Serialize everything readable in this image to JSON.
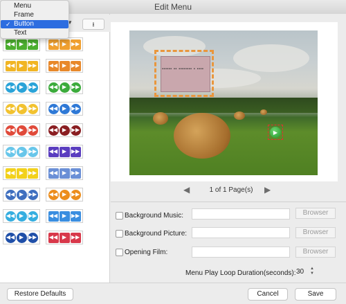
{
  "window": {
    "title": "Edit Menu"
  },
  "toolbar": {
    "download_glyph": "⭳"
  },
  "object_menu": {
    "items": [
      {
        "label": "Menu",
        "checked": false
      },
      {
        "label": "Frame",
        "checked": false
      },
      {
        "label": "Button",
        "checked": true
      },
      {
        "label": "Text",
        "checked": false
      }
    ],
    "check_glyph": "✓"
  },
  "button_styles": [
    {
      "color": "#4caf2f",
      "glyphs": [
        "◀◀",
        "▶",
        "▶▶"
      ],
      "round": false
    },
    {
      "color": "#f0a030",
      "glyphs": [
        "◀◀",
        "▶",
        "▶▶"
      ],
      "round": false
    },
    {
      "color": "#f1b524",
      "glyphs": [
        "◀◀",
        "▶",
        "▶▶"
      ],
      "round": false
    },
    {
      "color": "#e8882a",
      "glyphs": [
        "◀◀",
        "▶",
        "▶▶"
      ],
      "round": false
    },
    {
      "color": "#2aa3d8",
      "glyphs": [
        "◀◀",
        "▶",
        "▶▶"
      ],
      "round": true
    },
    {
      "color": "#3cab3c",
      "glyphs": [
        "◀◀",
        "▶",
        "▶▶"
      ],
      "round": true
    },
    {
      "color": "#f2c230",
      "glyphs": [
        "◀◀",
        "▶",
        "▶▶"
      ],
      "round": true
    },
    {
      "color": "#2f79d6",
      "glyphs": [
        "◀◀",
        "▶",
        "▶▶"
      ],
      "round": true
    },
    {
      "color": "#e04a3a",
      "glyphs": [
        "◀◀",
        "▶",
        "▶▶"
      ],
      "round": true
    },
    {
      "color": "#8a1e22",
      "glyphs": [
        "◀◀",
        "▶",
        "▶▶"
      ],
      "round": true
    },
    {
      "color": "#68c6ea",
      "glyphs": [
        "◀◀",
        "▶",
        "▶▶"
      ],
      "round": true
    },
    {
      "color": "#5a3dbf",
      "glyphs": [
        "◀◀",
        "▶",
        "▶▶"
      ],
      "round": false
    },
    {
      "color": "#f2d11c",
      "glyphs": [
        "◀◀",
        "▶",
        "▶▶"
      ],
      "round": false
    },
    {
      "color": "#6a8fd6",
      "glyphs": [
        "◀◀",
        "▶",
        "▶▶"
      ],
      "round": false
    },
    {
      "color": "#3f6fbf",
      "glyphs": [
        "◀◀",
        "▶",
        "▶▶"
      ],
      "round": true
    },
    {
      "color": "#ec8d1c",
      "glyphs": [
        "◀◀",
        "▶",
        "▶▶"
      ],
      "round": true
    },
    {
      "color": "#35aee0",
      "glyphs": [
        "◀◀",
        "▶",
        "▶▶"
      ],
      "round": true
    },
    {
      "color": "#3a8ee0",
      "glyphs": [
        "◀◀",
        "▶",
        "▶▶"
      ],
      "round": false
    },
    {
      "color": "#1f4fa8",
      "glyphs": [
        "◀◀",
        "▶",
        "▶▶"
      ],
      "round": true
    },
    {
      "color": "#d8384a",
      "glyphs": [
        "◀◀",
        "▶",
        "▶▶"
      ],
      "round": false
    }
  ],
  "preview": {
    "frame_caption": "▪▪▪▪▪▪ ▪▪ ▪▪▪▪▪▪▪▪ ▪ ▪▪▪▪",
    "play_glyph": "▶"
  },
  "pager": {
    "label": "1 of 1 Page(s)",
    "prev_glyph": "◀",
    "next_glyph": "▶"
  },
  "settings": {
    "rows": [
      {
        "label": "Background Music:",
        "field_value": "",
        "browse_label": "Browser"
      },
      {
        "label": "Background Picture:",
        "field_value": "",
        "browse_label": "Browser"
      },
      {
        "label": "Opening Film:",
        "field_value": "",
        "browse_label": "Browser"
      }
    ],
    "loop_label": "Menu Play Loop Duration(seconds):",
    "loop_value": "30",
    "stepper_up": "▲",
    "stepper_down": "▼"
  },
  "footer": {
    "restore_label": "Restore Defaults",
    "cancel_label": "Cancel",
    "save_label": "Save"
  }
}
